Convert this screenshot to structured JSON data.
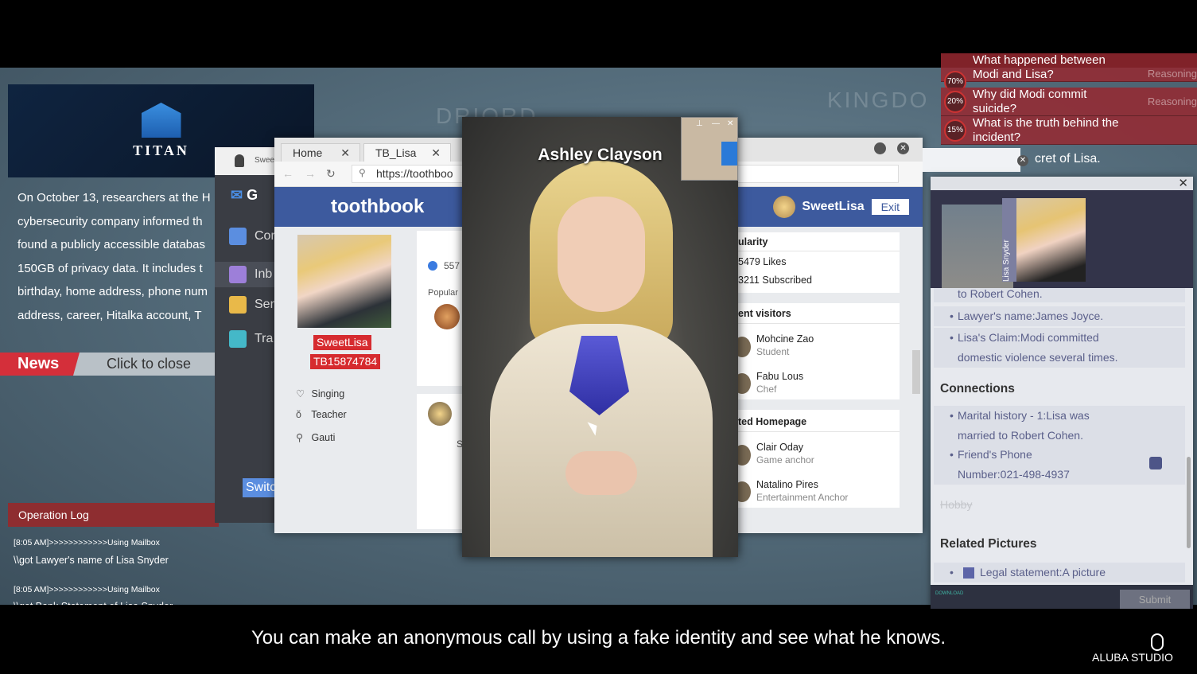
{
  "map_labels": [
    "DRIORD",
    "KINGDO"
  ],
  "news": {
    "logo": "TITAN",
    "lines": [
      "On October 13, researchers at the H",
      "cybersecurity company informed th",
      "found a publicly accessible databas",
      "150GB of privacy data. It includes t",
      "birthday, home address, phone num",
      "address, career, Hitalka account, T"
    ],
    "tag": "News",
    "close": "Click to close"
  },
  "operation_log": {
    "title": "Operation Log",
    "entries": [
      {
        "time": "[8:05 AM]>>>>>>>>>>>>Using Mailbox",
        "text": "\\\\got Lawyer's name of Lisa Snyder"
      },
      {
        "time": "[8:05 AM]>>>>>>>>>>>>Using Mailbox",
        "text": "\\\\got Bank Statement of Lisa Snyder"
      }
    ]
  },
  "mail": {
    "user": "Swee",
    "logo_letter": "G",
    "items": [
      "Cor",
      "Inb",
      "Ser",
      "Tra"
    ],
    "switch": "Switc"
  },
  "browser": {
    "tabs": [
      {
        "label": "Home"
      },
      {
        "label": "TB_Lisa"
      }
    ],
    "url": "https://toothboo",
    "brand": "toothbook",
    "profile": {
      "username": "SweetLisa",
      "id": "TB15874784",
      "attributes": [
        {
          "icon": "heart-icon",
          "label": "Singing"
        },
        {
          "icon": "tie-icon",
          "label": "Teacher"
        },
        {
          "icon": "location-icon",
          "label": "Gauti"
        }
      ]
    },
    "feed": {
      "likes": "557",
      "popular": "Popular",
      "s": "S"
    },
    "user": {
      "name": "SweetLisa",
      "exit": "Exit"
    },
    "popularity": {
      "title": "ularity",
      "likes": "5479 Likes",
      "subscribed": "3211 Subscribed"
    },
    "visitors": {
      "title": "ent visitors",
      "items": [
        {
          "name": "Mohcine Zao",
          "role": "Student"
        },
        {
          "name": "Fabu Lous",
          "role": "Chef"
        }
      ]
    },
    "related": {
      "title": "ted Homepage",
      "items": [
        {
          "name": "Clair Oday",
          "role": "Game anchor"
        },
        {
          "name": "Natalino Pires",
          "role": "Entertainment Anchor"
        }
      ]
    }
  },
  "call": {
    "name": "Ashley Clayson"
  },
  "questions": [
    {
      "pct": "70%",
      "text": "What happened between Modi and Lisa?",
      "status": "Reasoning"
    },
    {
      "pct": "20%",
      "text": "Why did Modi commit suicide?",
      "status": "Reasoning"
    },
    {
      "pct": "15%",
      "text": "What is the truth behind the incident?",
      "status": ""
    }
  ],
  "hint": "cret of Lisa.",
  "dossier": {
    "portrait_labels": [
      "Lisa Snyder"
    ],
    "partial": "to Robert Cohen.",
    "items": [
      "Lawyer's name:James Joyce.",
      "Lisa's Claim:Modi committed domestic violence several times."
    ],
    "connections_title": "Connections",
    "connections": [
      "Marital history - 1:Lisa was married to Robert Cohen.",
      "Friend's Phone Number:021-498-4937"
    ],
    "hobby": "Hobby",
    "pictures_title": "Related Pictures",
    "pictures": [
      "Legal statement:A picture"
    ],
    "download": "DOWNLOAD",
    "submit": "Submit"
  },
  "subtitle": "You can make an anonymous call by using a fake identity and see what he knows.",
  "studio": "ALUBA STUDIO",
  "colors": {
    "accent_red": "#d62b2f",
    "toothbook_blue": "#3d5a9e",
    "log_red": "#8e2d30"
  }
}
